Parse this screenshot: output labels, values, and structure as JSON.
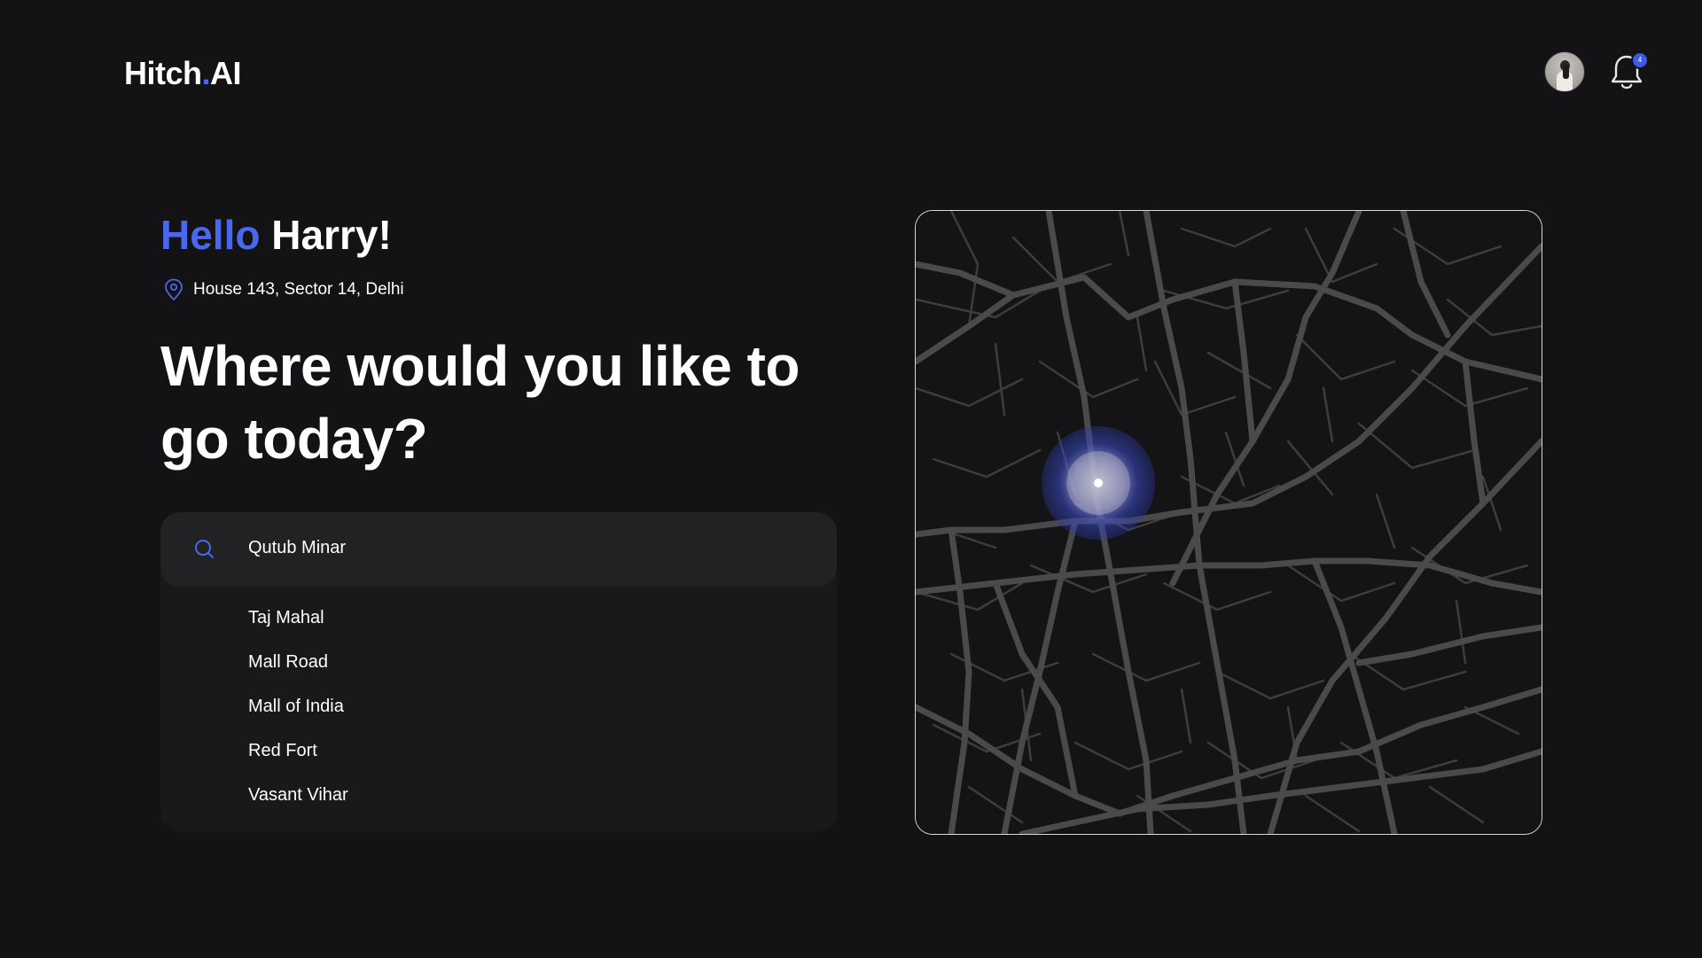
{
  "app": {
    "logo_main": "Hitch",
    "logo_dot": ".",
    "logo_suffix": "AI",
    "notification_count": "4",
    "accent_color": "#4a68ee"
  },
  "greeting": {
    "hello": "Hello",
    "name": "Harry!"
  },
  "location": {
    "address": "House 143, Sector 14, Delhi",
    "icon": "location-pin-icon"
  },
  "headline": "Where would you like to go today?",
  "search": {
    "value": "Qutub Minar",
    "icon": "search-icon"
  },
  "suggestions": [
    "Taj Mahal",
    "Mall Road",
    "Mall of India",
    "Red Fort",
    "Vasant Vihar"
  ],
  "map": {
    "theme": "dark",
    "marker": "current-location-marker"
  }
}
